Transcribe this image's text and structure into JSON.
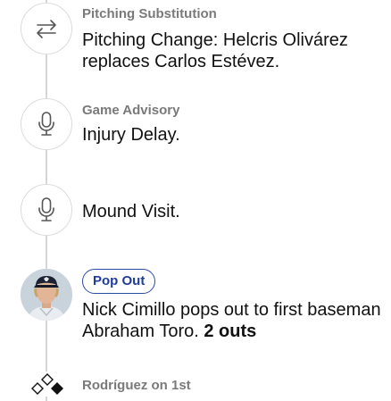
{
  "events": [
    {
      "category": "Pitching Substitution",
      "description": "Pitching Change: Helcris Olivárez replaces Carlos Estévez.",
      "icon": "swap-arrows-icon"
    },
    {
      "category": "Game Advisory",
      "description": "Injury Delay.",
      "icon": "microphone-icon"
    },
    {
      "description": "Mound Visit.",
      "icon": "microphone-icon"
    },
    {
      "badge": "Pop Out",
      "description": "Nick Cimillo pops out to first baseman Abraham Toro.",
      "outs": "2 outs",
      "icon": "player-avatar"
    },
    {
      "category": "Rodríguez on 1st",
      "icon": "bases-diamond-icon",
      "bases_occupied": [
        "first"
      ]
    }
  ],
  "colors": {
    "badge_accent": "#2d4aa6",
    "category_text": "#7a7a7a",
    "timeline": "#d6d6d6"
  }
}
